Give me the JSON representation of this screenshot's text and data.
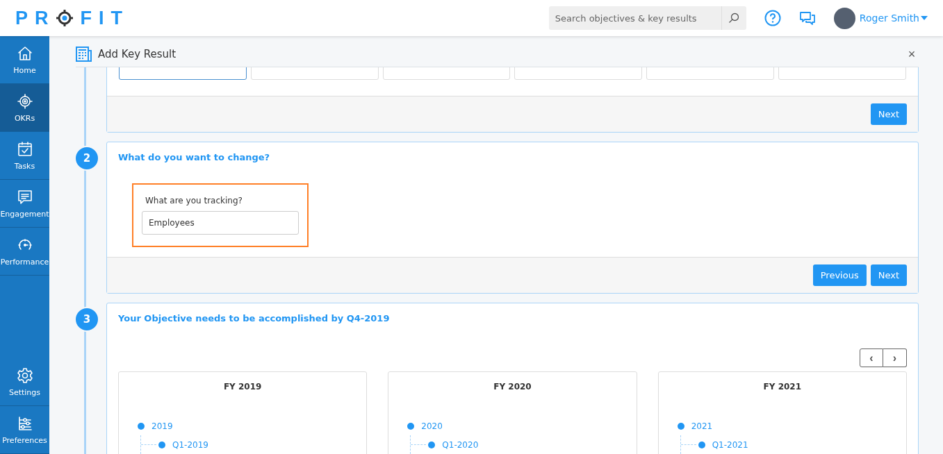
{
  "header": {
    "logo": {
      "left": "PR",
      "right": "FIT"
    },
    "search": {
      "placeholder": "Search objectives & key results"
    },
    "user": {
      "name": "Roger Smith"
    }
  },
  "sidebar": {
    "items": [
      {
        "label": "Home",
        "selected": false
      },
      {
        "label": "OKRs",
        "selected": true
      },
      {
        "label": "Tasks",
        "selected": false
      },
      {
        "label": "Engagement",
        "selected": false
      },
      {
        "label": "Performance",
        "selected": false
      }
    ],
    "bottom_items": [
      {
        "label": "Settings",
        "selected": false
      },
      {
        "label": "Preferences",
        "selected": false
      }
    ]
  },
  "modal": {
    "title": "Add Key Result",
    "close": "×",
    "steps": [
      {
        "kind": "options",
        "options": [
          {
            "selected": true
          },
          {
            "selected": false
          },
          {
            "selected": false
          },
          {
            "selected": false
          },
          {
            "selected": false
          },
          {
            "selected": false
          }
        ],
        "buttons": [
          "Next"
        ]
      },
      {
        "kind": "field",
        "number": "2",
        "title": "What do you want to change?",
        "field_label": "What are you tracking?",
        "value": "Employees",
        "highlighted": true,
        "buttons": [
          "Previous",
          "Next"
        ]
      },
      {
        "kind": "periods",
        "number": "3",
        "title": "Your Objective needs to be accomplished by Q4-2019",
        "pager": [
          "‹",
          "›"
        ],
        "fiscal_years": [
          {
            "title": "FY 2019",
            "tree": [
              {
                "label": "2019",
                "children": [
                  {
                    "label": "Q1-2019"
                  }
                ]
              }
            ]
          },
          {
            "title": "FY 2020",
            "tree": [
              {
                "label": "2020",
                "children": [
                  {
                    "label": "Q1-2020"
                  }
                ]
              }
            ]
          },
          {
            "title": "FY 2021",
            "tree": [
              {
                "label": "2021",
                "children": [
                  {
                    "label": "Q1-2021"
                  }
                ]
              }
            ]
          }
        ]
      }
    ]
  }
}
